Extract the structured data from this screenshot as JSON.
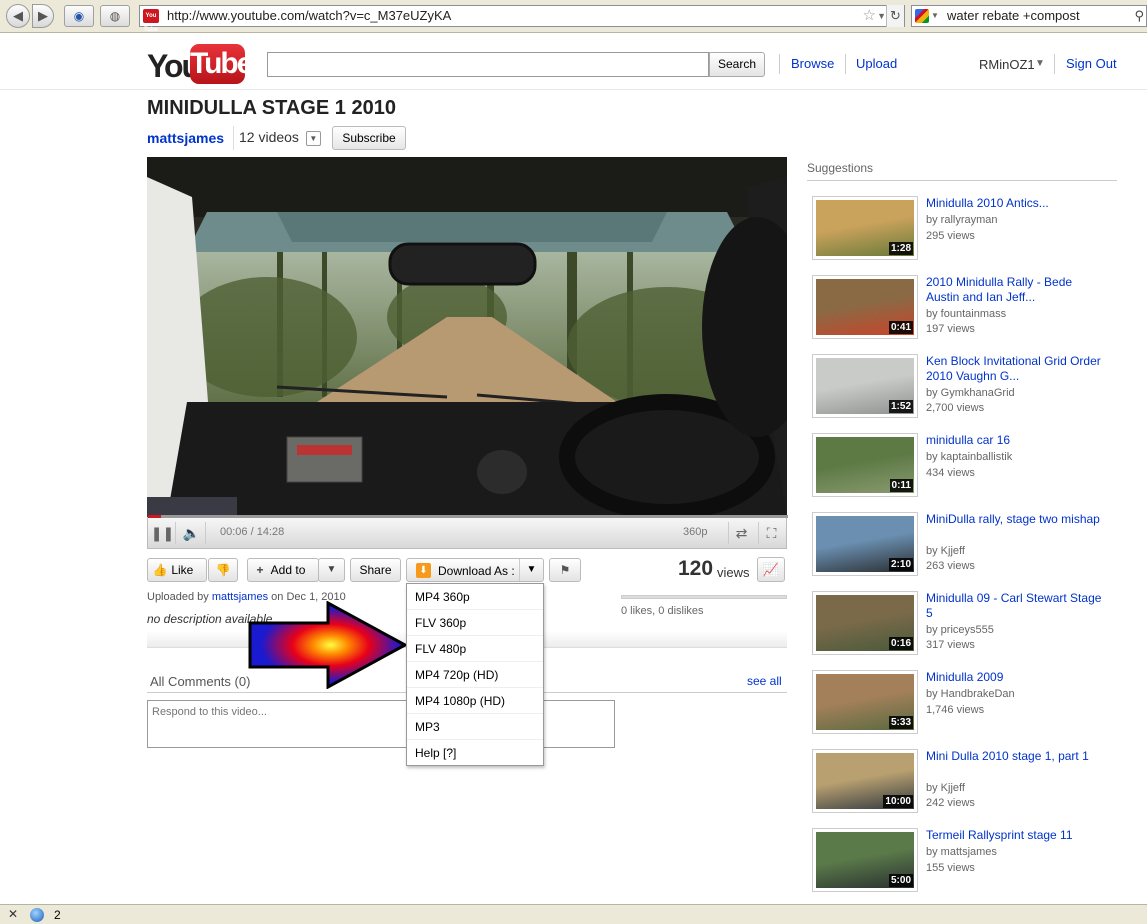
{
  "browser": {
    "url": "http://www.youtube.com/watch?v=c_M37eUZyKA",
    "search_text": "water rebate +compost",
    "favicon_text": "You Tube",
    "back_icon": "back-arrow-icon",
    "forward_icon": "forward-arrow-icon"
  },
  "header": {
    "logo_you": "You",
    "logo_tube": "Tube",
    "search_button": "Search",
    "search_value": "",
    "browse": "Browse",
    "upload": "Upload",
    "username": "RMinOZ1",
    "sign_out": "Sign Out"
  },
  "video": {
    "title": "MINIDULLA STAGE 1 2010",
    "channel": "mattsjames",
    "video_count": "12 videos",
    "subscribe": "Subscribe",
    "time": "00:06 / 14:28",
    "quality": "360p",
    "progress_fraction": 0.007
  },
  "actions": {
    "like": "Like",
    "add_to": "Add to",
    "share": "Share",
    "download": "Download As :",
    "views_number": "120",
    "views_label": "views"
  },
  "download_menu": [
    "MP4 360p",
    "FLV 360p",
    "FLV 480p",
    "MP4 720p (HD)",
    "MP4 1080p (HD)",
    "MP3",
    "Help [?]"
  ],
  "info": {
    "uploaded_prefix": "Uploaded by",
    "uploader": "mattsjames",
    "uploaded_date": "on Dec 1, 2010",
    "description": "no description available",
    "likes": "0 likes, 0 dislikes"
  },
  "comments": {
    "title": "All Comments (0)",
    "see_all": "see all",
    "placeholder": "Respond to this video..."
  },
  "suggestions": {
    "heading": "Suggestions",
    "items": [
      {
        "title": "Minidulla 2010 Antics...",
        "by": "by rallyrayman",
        "views": "295 views",
        "duration": "1:28",
        "colors": [
          "#c9a25c",
          "#6a7a3a"
        ]
      },
      {
        "title": "2010 Minidulla Rally - Bede Austin and Ian Jeff...",
        "by": "by fountainmass",
        "views": "197 views",
        "duration": "0:41",
        "colors": [
          "#8a6a45",
          "#c8452a"
        ]
      },
      {
        "title": "Ken Block Invitational Grid Order 2010 Vaughn G...",
        "by": "by GymkhanaGrid",
        "views": "2,700 views",
        "duration": "1:52",
        "colors": [
          "#c9cbc8",
          "#8f9290"
        ]
      },
      {
        "title": "minidulla car 16",
        "by": "by kaptainballistik",
        "views": "434 views",
        "duration": "0:11",
        "colors": [
          "#5d7a45",
          "#8a9a70"
        ]
      },
      {
        "title": "MiniDulla rally, stage two mishap",
        "by": "by Kjjeff",
        "views": "263 views",
        "duration": "2:10",
        "colors": [
          "#6a8fb0",
          "#2b2f33"
        ]
      },
      {
        "title": "Minidulla 09 - Carl Stewart Stage 5",
        "by": "by priceys555",
        "views": "317 views",
        "duration": "0:16",
        "colors": [
          "#7a6a4a",
          "#4a5a3a"
        ]
      },
      {
        "title": "Minidulla 2009",
        "by": "by HandbrakeDan",
        "views": "1,746 views",
        "duration": "5:33",
        "colors": [
          "#a3805a",
          "#5a6a40"
        ]
      },
      {
        "title": "Mini Dulla 2010 stage 1, part 1",
        "by": "by Kjjeff",
        "views": "242 views",
        "duration": "10:00",
        "colors": [
          "#b8a070",
          "#333a40"
        ]
      },
      {
        "title": "Termeil Rallysprint stage 11",
        "by": "by mattsjames",
        "views": "155 views",
        "duration": "5:00",
        "colors": [
          "#5a7a4a",
          "#2a3030"
        ]
      }
    ]
  },
  "status_bar": {
    "count": "2"
  }
}
